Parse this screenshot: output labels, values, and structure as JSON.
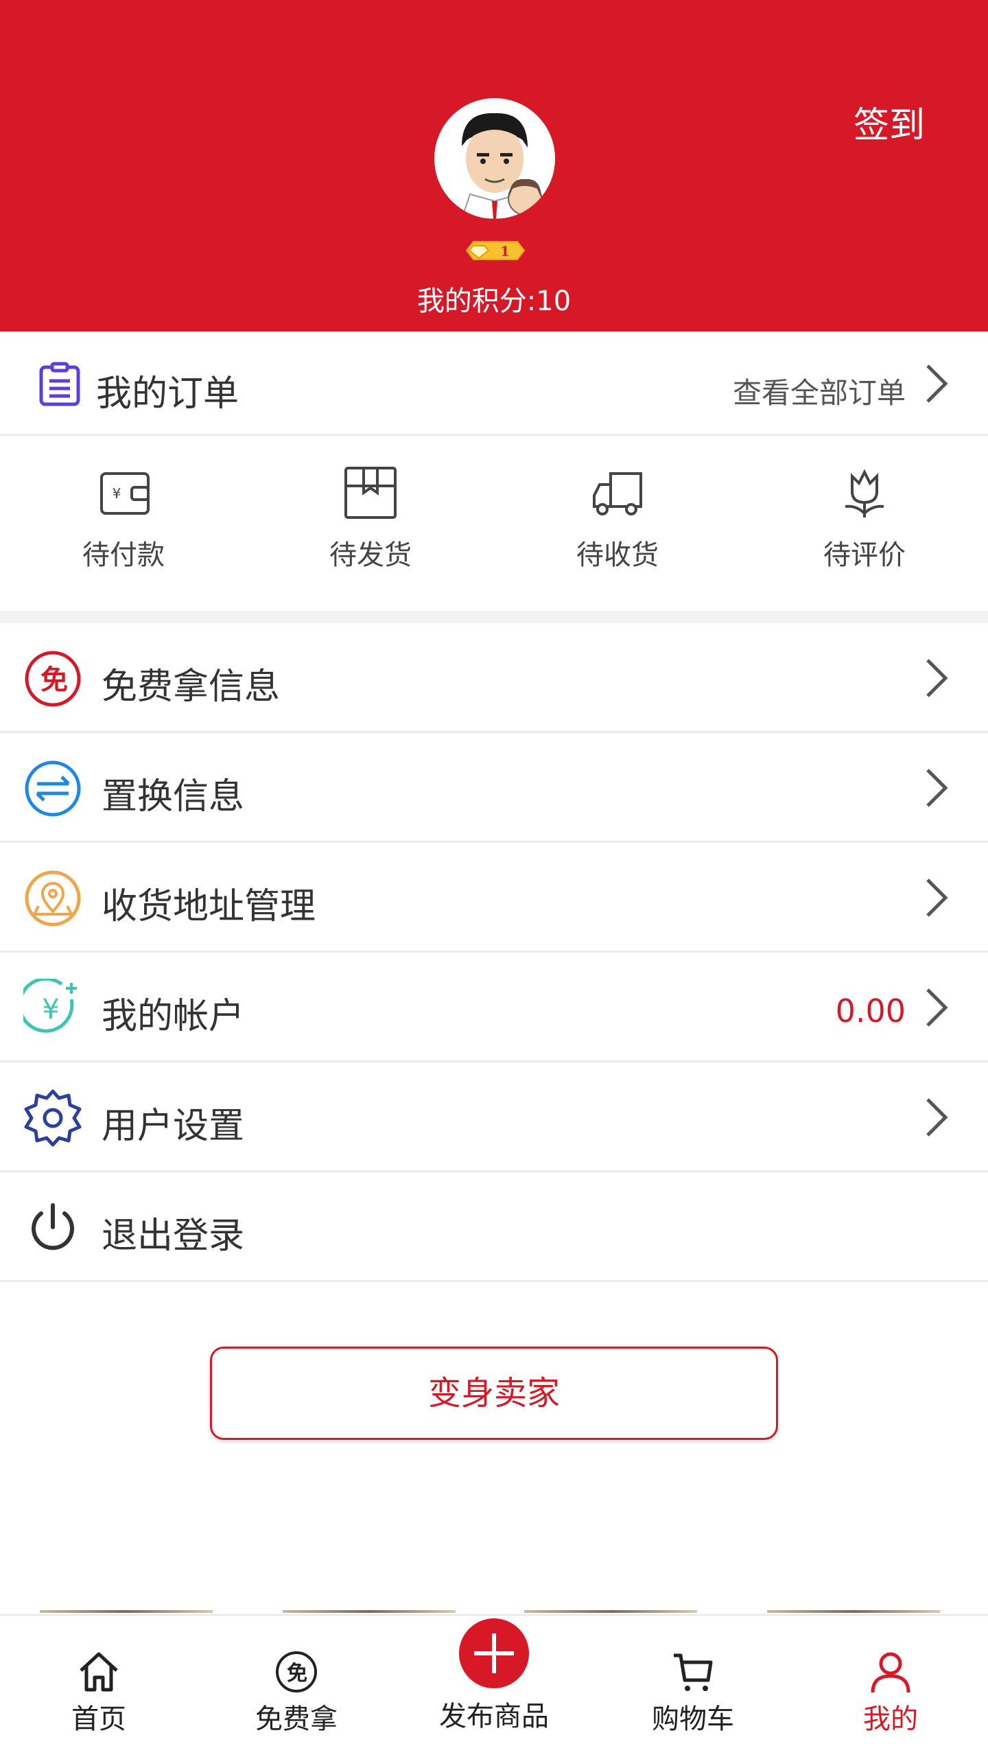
{
  "header": {
    "checkin_label": "签到",
    "level": "1",
    "points_text": "我的积分:10",
    "bg_color": "#d71927"
  },
  "orders": {
    "title": "我的订单",
    "view_all": "查看全部订单",
    "icon": "clipboard-icon",
    "statuses": [
      {
        "label": "待付款",
        "icon": "wallet-icon"
      },
      {
        "label": "待发货",
        "icon": "box-icon"
      },
      {
        "label": "待收货",
        "icon": "truck-icon"
      },
      {
        "label": "待评价",
        "icon": "flower-icon"
      }
    ]
  },
  "menu": [
    {
      "label": "免费拿信息",
      "icon": "free-icon",
      "color": "#d71927"
    },
    {
      "label": "置换信息",
      "icon": "exchange-icon",
      "color": "#1e88e5"
    },
    {
      "label": "收货地址管理",
      "icon": "map-pin-icon",
      "color": "#f0a548"
    },
    {
      "label": "我的帐户",
      "icon": "yuan-icon",
      "color": "#3fc4b0",
      "value": "0.00"
    },
    {
      "label": "用户设置",
      "icon": "gear-icon",
      "color": "#2a3f9e"
    },
    {
      "label": "退出登录",
      "icon": "power-icon",
      "color": "#333333"
    }
  ],
  "seller_button": "变身卖家",
  "bottom_nav": {
    "items": [
      {
        "label": "首页",
        "icon": "home-icon"
      },
      {
        "label": "免费拿",
        "icon": "free-icon"
      },
      {
        "label": "发布商品",
        "icon": "plus-icon"
      },
      {
        "label": "购物车",
        "icon": "cart-icon"
      },
      {
        "label": "我的",
        "icon": "user-icon",
        "active": true
      }
    ],
    "active_color": "#d71927"
  }
}
